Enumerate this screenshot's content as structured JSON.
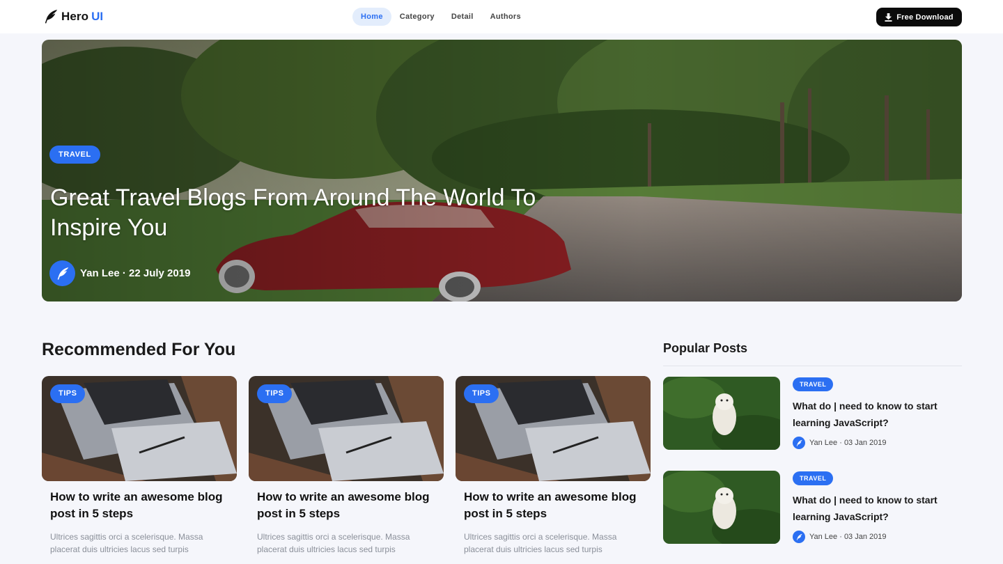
{
  "brand": {
    "name": "Hero",
    "accent": "UI",
    "logo_icon": "feather-icon"
  },
  "nav": {
    "links": [
      "Home",
      "Category",
      "Detail",
      "Authors"
    ],
    "active": "Home"
  },
  "download": {
    "label": "Free Download",
    "icon": "download-icon"
  },
  "hero": {
    "category": "TRAVEL",
    "title": "Great Travel Blogs From Around The World To Inspire You",
    "author_line": "Yan Lee · 22 July 2019"
  },
  "recommended": {
    "title": "Recommended For You",
    "cards": [
      {
        "category": "TIPS",
        "title": "How to write an awesome blog post in 5 steps",
        "excerpt": "Ultrices sagittis orci a scelerisque. Massa placerat duis ultricies lacus sed turpis"
      },
      {
        "category": "TIPS",
        "title": "How to write an awesome blog post in 5 steps",
        "excerpt": "Ultrices sagittis orci a scelerisque. Massa placerat duis ultricies lacus sed turpis"
      },
      {
        "category": "TIPS",
        "title": "How to write an awesome blog post in 5 steps",
        "excerpt": "Ultrices sagittis orci a scelerisque. Massa placerat duis ultricies lacus sed turpis"
      }
    ]
  },
  "popular": {
    "title": "Popular Posts",
    "posts": [
      {
        "category": "TRAVEL",
        "title": "What do | need to know to start learning JavaScript?",
        "author_line": "Yan Lee · 03 Jan 2019"
      },
      {
        "category": "TRAVEL",
        "title": "What do | need to know to start learning JavaScript?",
        "author_line": "Yan Lee · 03 Jan 2019"
      }
    ]
  },
  "colors": {
    "accent": "#2b6ff2",
    "background": "#f5f6fb",
    "nav_active_bg": "#e3edfc",
    "button_dark": "#0b0b0b"
  }
}
